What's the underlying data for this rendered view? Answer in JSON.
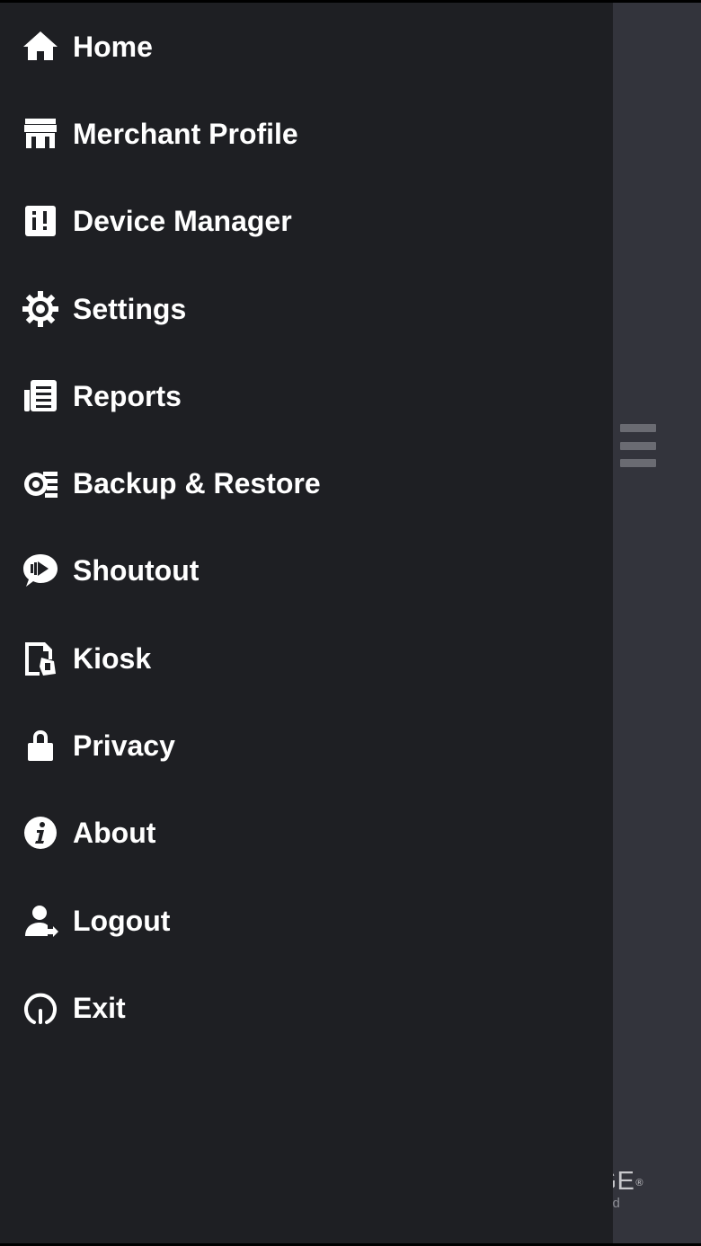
{
  "menu": {
    "items": [
      {
        "label": "Home",
        "icon": "home-icon"
      },
      {
        "label": "Merchant Profile",
        "icon": "storefront-icon"
      },
      {
        "label": "Device Manager",
        "icon": "device-manager-icon"
      },
      {
        "label": "Settings",
        "icon": "gear-icon"
      },
      {
        "label": "Reports",
        "icon": "reports-icon"
      },
      {
        "label": "Backup & Restore",
        "icon": "backup-icon"
      },
      {
        "label": "Shoutout",
        "icon": "shoutout-icon"
      },
      {
        "label": "Kiosk",
        "icon": "kiosk-icon"
      },
      {
        "label": "Privacy",
        "icon": "lock-icon"
      },
      {
        "label": "About",
        "icon": "info-icon"
      },
      {
        "label": "Logout",
        "icon": "logout-icon"
      },
      {
        "label": "Exit",
        "icon": "power-icon"
      }
    ]
  },
  "brand": {
    "name": "DGE",
    "reg": "®",
    "tagline": "e good"
  },
  "colors": {
    "drawer_bg": "#1e1f23",
    "backdrop_bg": "#33343c",
    "text": "#ffffff",
    "hamburger": "#6a6b72"
  }
}
